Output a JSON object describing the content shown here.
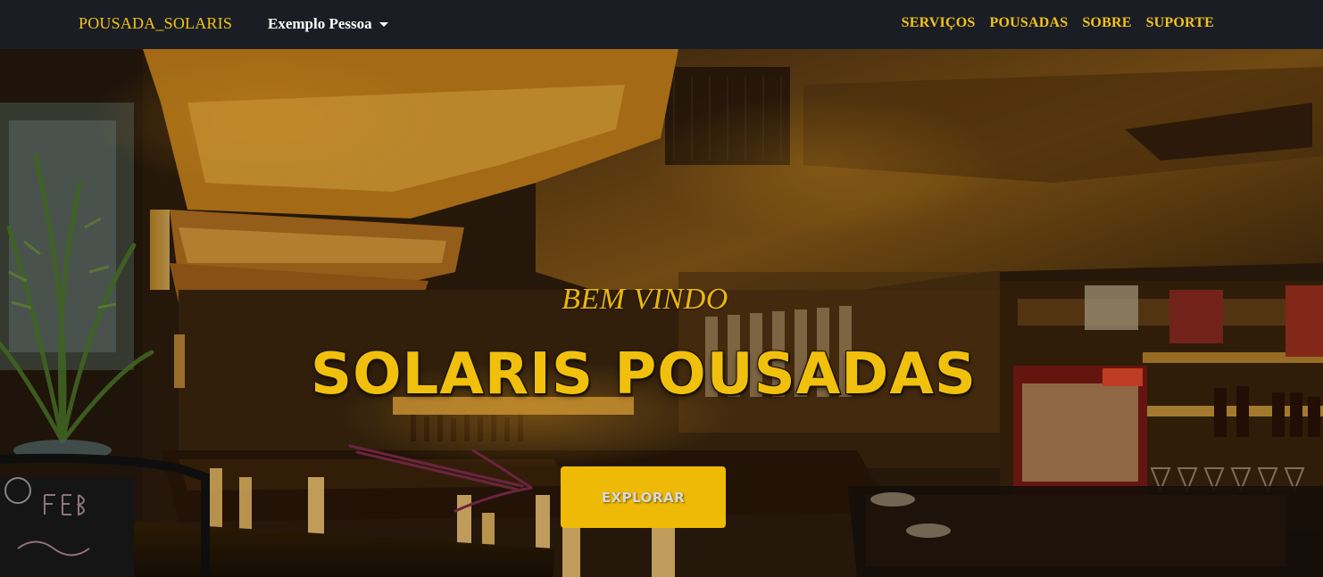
{
  "navbar": {
    "brand": "POUSADA_SOLARIS",
    "user_menu": "Exemplo Pessoa",
    "links": [
      "SERVIÇOS",
      "POUSADAS",
      "SOBRE",
      "SUPORTE"
    ]
  },
  "hero": {
    "subtitle": "BEM VINDO",
    "title": "SOLARIS POUSADAS",
    "cta_label": "EXPLORAR"
  },
  "colors": {
    "navbar_bg": "#1a1e24",
    "accent": "#f3c218",
    "button_bg": "#efba06",
    "annotation_arrow": "#6b2441"
  },
  "icons": {
    "user_menu_caret": "caret-down-icon",
    "annotation": "arrow-right-icon"
  }
}
